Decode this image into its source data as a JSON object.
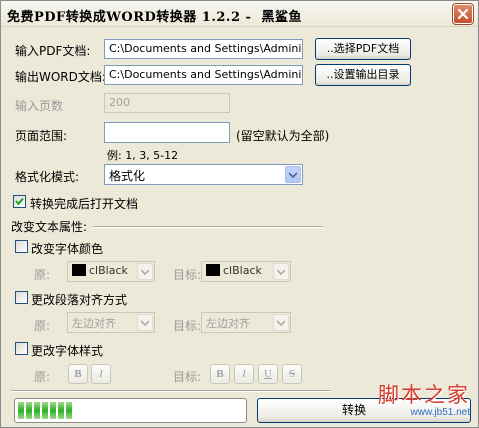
{
  "window": {
    "title": "免费PDF转换成WORD转换器 1.2.2 -  黑鲨鱼"
  },
  "fields": {
    "input_pdf": {
      "label": "输入PDF文档:",
      "value": "C:\\Documents and Settings\\Administrato",
      "button": "..选择PDF文档"
    },
    "output_word": {
      "label": "输出WORD文档:",
      "value": "C:\\Documents and Settings\\Administrato",
      "button": "..设置输出目录"
    },
    "page_count": {
      "label": "输入页数",
      "value": "200"
    },
    "page_range": {
      "label": "页面范围:",
      "value": "",
      "hint": "(留空默认为全部)",
      "example": "例: 1, 3, 5-12"
    },
    "format_mode": {
      "label": "格式化模式:",
      "value": "格式化"
    }
  },
  "open_after": {
    "label": "转换完成后打开文档",
    "checked": true
  },
  "text_props": {
    "header": "改变文本属性:",
    "font_color": {
      "label": "改变字体颜色",
      "checked": false,
      "orig_label": "原:",
      "orig_value": "clBlack",
      "target_label": "目标:",
      "target_value": "clBlack",
      "swatch_color": "#000000"
    },
    "alignment": {
      "label": "更改段落对齐方式",
      "checked": false,
      "orig_label": "原:",
      "orig_value": "左边对齐",
      "target_label": "目标:",
      "target_value": "左边对齐"
    },
    "font_style": {
      "label": "更改字体样式",
      "checked": false,
      "orig_label": "原:",
      "target_label": "目标:",
      "orig_buttons": [
        "B",
        "I"
      ],
      "target_buttons": [
        "B",
        "I",
        "U",
        "S"
      ]
    }
  },
  "progress": {
    "segments": 7
  },
  "convert_button": {
    "label": "转换"
  },
  "watermark": {
    "text": "脚本之家",
    "sub": "www.jb51.net"
  },
  "colors": {
    "accent": "#316ac5",
    "progress_green": "#2fb02a",
    "checkmark": "#21a121"
  }
}
